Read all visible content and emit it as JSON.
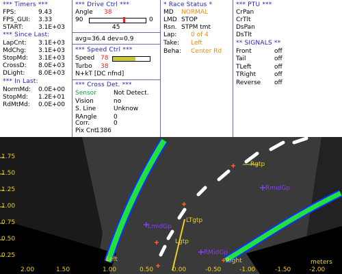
{
  "timers": {
    "header": "*** Timers ***",
    "fps_label": "FPS:",
    "fps": "9.43",
    "fpsgui_label": "FPS_GUI:",
    "fpsgui": "3.33",
    "start_label": "START:",
    "start": "3.1E+03",
    "since_header": "*** Since Last:",
    "lapcnt_label": "LapCnt:",
    "lapcnt": "3.1E+03",
    "mdchg_label": "MdChg:",
    "mdchg": "3.1E+03",
    "stopmd_label": "StopMd:",
    "stopmd": "3.1E+03",
    "crossd_label": "CrossD:",
    "crossd": "8.0E+03",
    "dlight_label": "DLight:",
    "dlight": "8.0E+03",
    "inlast_header": "*** In Last:",
    "normmd_label": "NormMd:",
    "normmd": "0.0E+00",
    "stopmd2_label": "StopMd:",
    "stopmd2": "1.2E+01",
    "rdmtmd_label": "RdMtMd:",
    "rdmtmd": "0.0E+00"
  },
  "drive": {
    "header": "*** Drive Ctrl ***",
    "angle_label": "Angle",
    "angle": "38",
    "angle_level": 0.62,
    "scale_left": "90",
    "scale_right": "0",
    "center_value": "45",
    "avg_text": "avg=36.4 dev=0.9"
  },
  "speed": {
    "header": "*** Speed Ctrl ***",
    "speed_label": "Speed",
    "speed": "78",
    "speed_level": 0.62,
    "turbo_label": "Turbo",
    "turbo": "38",
    "mode_text": "N+kT [DC nfnd]"
  },
  "cross": {
    "header": "*** Cross Det. ***",
    "sensor_label": "Sensor",
    "sensor": "Not Detect.",
    "vision_label": "Vision",
    "vision": "no",
    "sline_label": "S. Line",
    "sline": "Unknow",
    "rangle_label": "RAngle",
    "rangle": "0",
    "corr_label": "Corr.",
    "corr": "0",
    "pixcnt_label": "Pix Cnt",
    "pixcnt": "1386"
  },
  "race": {
    "header": "* Race Status *",
    "md_label": "MD",
    "md": "NORMAL",
    "lmd_label": "LMD",
    "lmd": "STOP",
    "rsn_label": "Rsn.",
    "rsn": "STPM tmt",
    "lap_label": "Lap:",
    "lap": "0 of 4",
    "take_label": "Take:",
    "take": "Left",
    "beha_label": "Beha:",
    "beha": "Center Rd"
  },
  "ptu": {
    "header": "*** PTU ***",
    "items": [
      "CrPan",
      "CrTlt",
      "DsPan",
      "DsTlt"
    ],
    "signals_header": "** SIGNALS **",
    "signals": [
      {
        "label": "Front",
        "value": "off"
      },
      {
        "label": "Tail",
        "value": "off"
      },
      {
        "label": "TLeft",
        "value": "off"
      },
      {
        "label": "TRight",
        "value": "off"
      },
      {
        "label": "Reverse",
        "value": "off"
      }
    ]
  },
  "camera": {
    "y_ticks": [
      "1.75",
      "1.50",
      "1.25",
      "1.00",
      "0.75",
      "0.50",
      "0.25"
    ],
    "x_ticks": [
      "2.00",
      "1.50",
      "1.00",
      "0.50",
      "0.00",
      "-0.50",
      "-1.00",
      "-1.50",
      "-2.00"
    ],
    "x_unit": "meters",
    "labels": {
      "rgtp": "Rgtp",
      "rmidgp": "RmidGp",
      "ltgtp": "LTgtp",
      "lmidgp": "LmidGp",
      "lgtp": "Lgtp",
      "left": "Left",
      "right": "Right",
      "rmid": "RMidGp"
    },
    "colors": {
      "lane_fill": "#22e040",
      "lane_edge": "#1030ff",
      "marker_yellow": "#f0d020",
      "marker_purple": "#8a3cff",
      "orange_cross": "#ff6020"
    }
  }
}
